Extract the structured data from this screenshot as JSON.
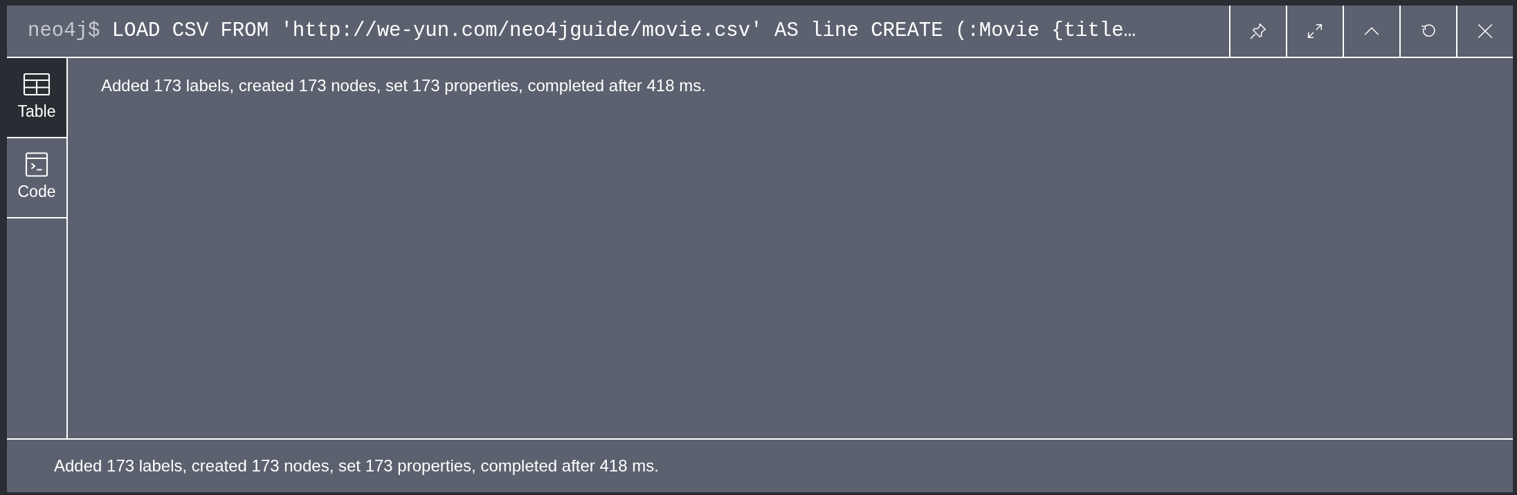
{
  "header": {
    "prompt": "neo4j$",
    "query": "LOAD CSV FROM 'http://we-yun.com/neo4jguide/movie.csv' AS line CREATE (:Movie {title…"
  },
  "header_buttons": [
    {
      "kind": "pin"
    },
    {
      "kind": "expand"
    },
    {
      "kind": "collapse"
    },
    {
      "kind": "rerun"
    },
    {
      "kind": "close"
    }
  ],
  "tabs": [
    {
      "label": "Table",
      "kind": "table",
      "selected": true
    },
    {
      "label": "Code",
      "kind": "code",
      "selected": false
    }
  ],
  "result_message": "Added 173 labels, created 173 nodes, set 173 properties, completed after 418 ms.",
  "status_bar": "Added 173 labels, created 173 nodes, set 173 properties, completed after 418 ms."
}
